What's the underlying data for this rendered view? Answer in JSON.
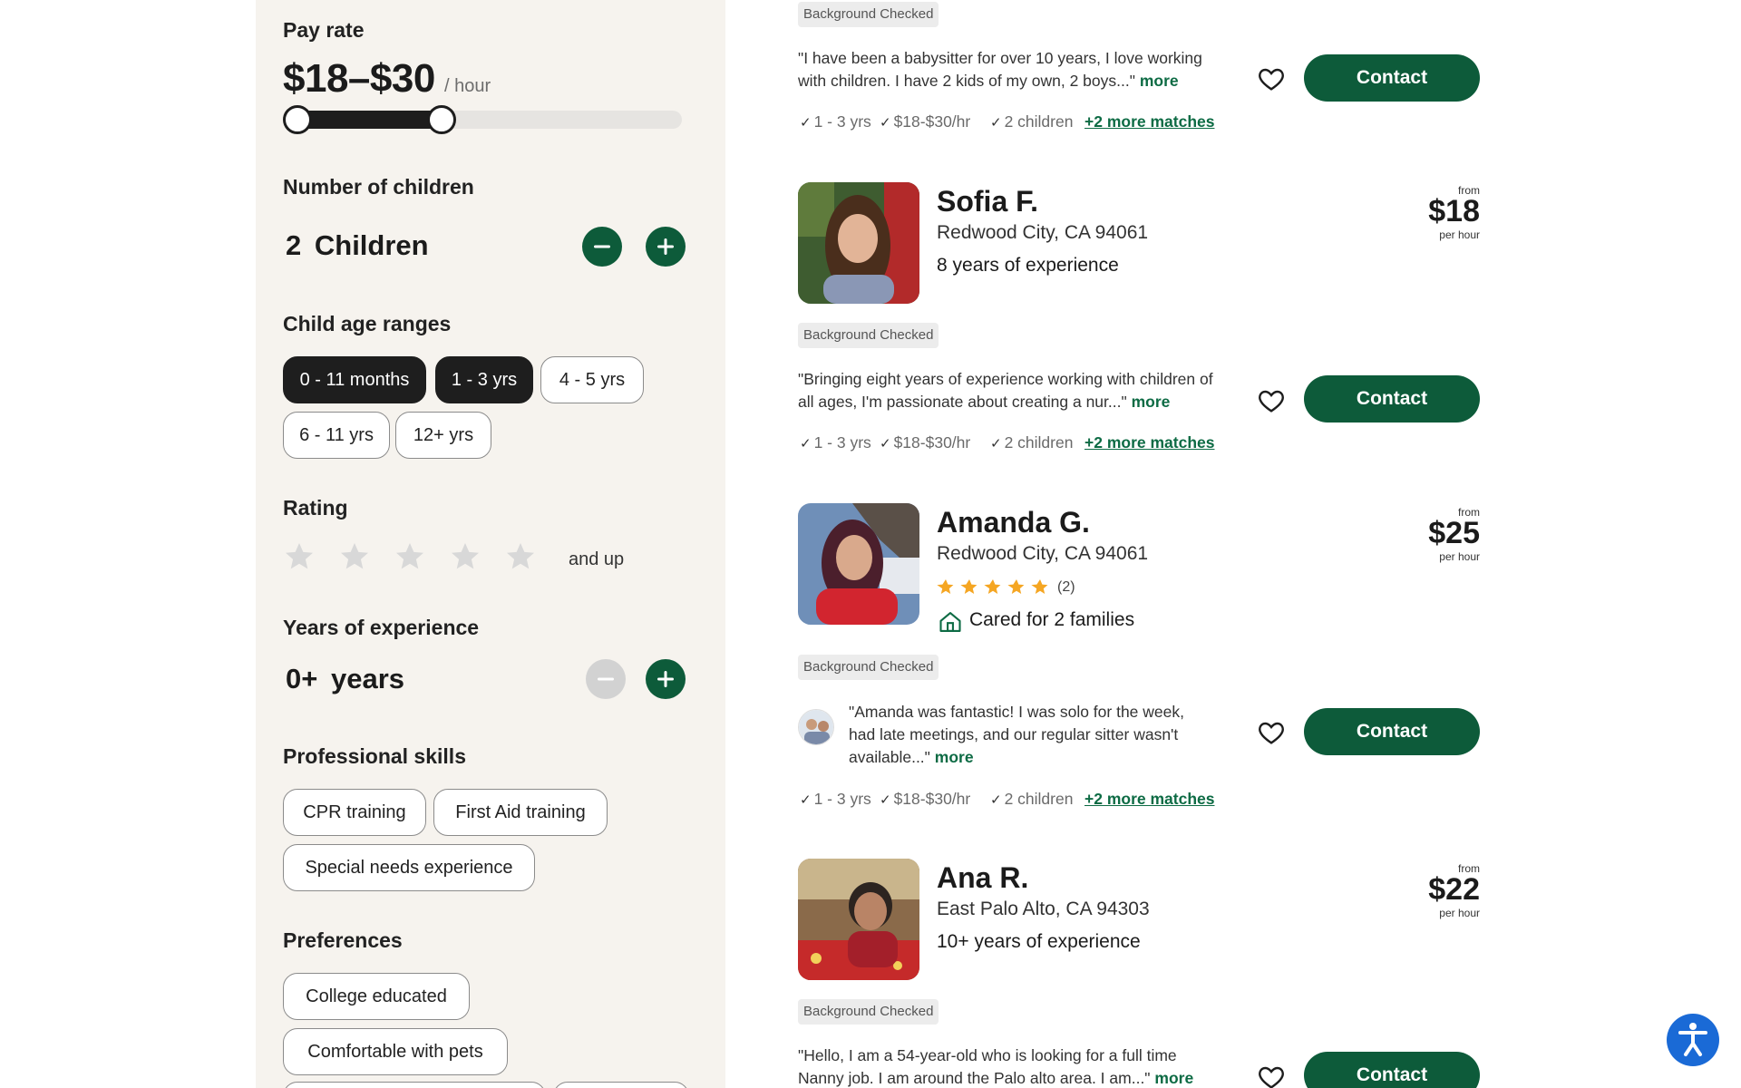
{
  "filters": {
    "pay_rate": {
      "title": "Pay rate",
      "value": "$18–$30",
      "unit": "/ hour",
      "range_min_fraction": 0.0,
      "range_max_fraction": 0.37
    },
    "children": {
      "title": "Number of children",
      "count": "2",
      "label": "Children"
    },
    "age_ranges": {
      "title": "Child age ranges",
      "options": [
        {
          "label": "0 - 11 months",
          "selected": true
        },
        {
          "label": "1 - 3 yrs",
          "selected": true
        },
        {
          "label": "4 - 5 yrs",
          "selected": false
        },
        {
          "label": "6 - 11 yrs",
          "selected": false
        },
        {
          "label": "12+ yrs",
          "selected": false
        }
      ]
    },
    "rating": {
      "title": "Rating",
      "selected_stars": 0,
      "suffix": "and up"
    },
    "experience": {
      "title": "Years of experience",
      "value": "0+",
      "label": "years"
    },
    "skills": {
      "title": "Professional skills",
      "options": [
        "CPR training",
        "First Aid training",
        "Special needs experience"
      ]
    },
    "preferences": {
      "title": "Preferences",
      "options": [
        "College educated",
        "Comfortable with pets"
      ]
    }
  },
  "icons": {
    "heart": "heart-outline-icon",
    "check": "check-icon",
    "minus": "minus-icon",
    "plus": "plus-icon",
    "star": "star-icon",
    "home": "home-icon",
    "accessibility": "accessibility-icon"
  },
  "colors": {
    "accent": "#0d5b3a",
    "link": "#0d6b44",
    "star_gold": "#f5a623",
    "a11y_blue": "#1a6ad6"
  },
  "results": {
    "badge_label": "Background Checked",
    "more_label": "more",
    "contact_label": "Contact",
    "price_from": "from",
    "price_per": "per hour",
    "first": {
      "quote": "\"I have been a babysitter for over 10 years, I love working with children. I have 2 kids of my own, 2 boys...\"",
      "matches": [
        "1 - 3 yrs",
        "$18-$30/hr",
        "2 children"
      ],
      "more_matches": "+2 more matches"
    },
    "sofia": {
      "name": "Sofia F.",
      "location": "Redwood City, CA 94061",
      "experience": "8 years of experience",
      "price": "$18",
      "quote": "\"Bringing eight years of experience working with children of all ages, I'm passionate about creating a nur...\"",
      "matches": [
        "1 - 3 yrs",
        "$18-$30/hr",
        "2 children"
      ],
      "more_matches": "+2 more matches"
    },
    "amanda": {
      "name": "Amanda G.",
      "location": "Redwood City, CA 94061",
      "rating": 5,
      "review_count": "(2)",
      "families": "Cared for 2 families",
      "price": "$25",
      "review": "\"Amanda was fantastic! I was solo for the week, had late meetings, and our regular sitter wasn't available...\"",
      "matches": [
        "1 - 3 yrs",
        "$18-$30/hr",
        "2 children"
      ],
      "more_matches": "+2 more matches"
    },
    "ana": {
      "name": "Ana R.",
      "location": "East Palo Alto, CA 94303",
      "experience": "10+ years of experience",
      "price": "$22",
      "quote": "\"Hello, I am a 54-year-old who is looking for a full time Nanny job. I am around the Palo alto area. I am...\""
    }
  }
}
